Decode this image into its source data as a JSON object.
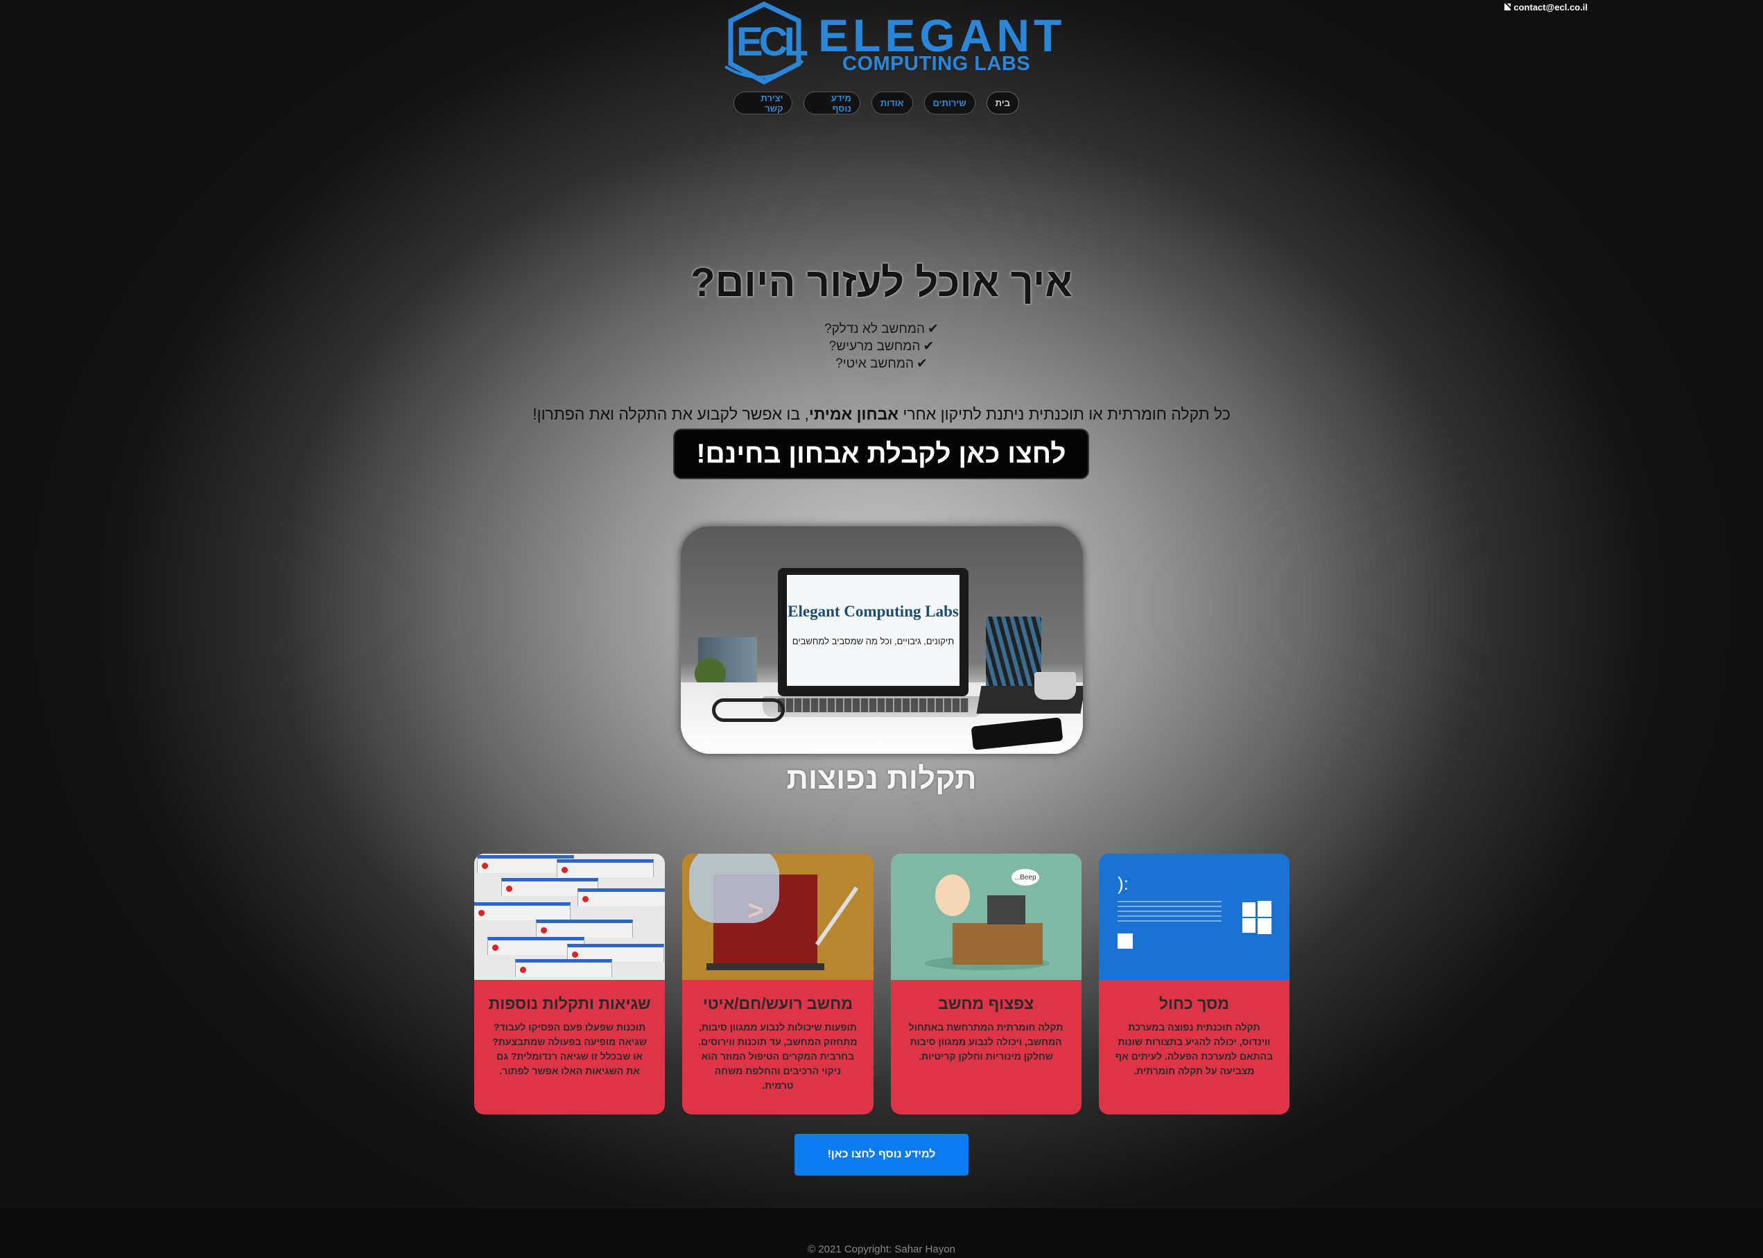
{
  "contact": {
    "email": "contact@ecl.co.il",
    "icon": "envelope-icon"
  },
  "brand": {
    "initials": "ECL",
    "name": "ELEGANT",
    "sub": "COMPUTING LABS",
    "color": "#2a86d8"
  },
  "nav": {
    "items": [
      "בית",
      "שירותים",
      "אודות",
      "מידע נוסף",
      "יצירת קשר"
    ]
  },
  "hero": {
    "title": "איך אוכל לעזור היום?",
    "checks": [
      "המחשב לא נדלק?",
      "המחשב מרעיש?",
      "המחשב איטי?"
    ],
    "statement_before": "כל תקלה חומרתית או תוכנתית ניתנת לתיקון אחרי ",
    "statement_bold": "אבחון אמיתי",
    "statement_after": ", בו אפשר לקבוע את התקלה ואת הפתרון!",
    "cta": "לחצו כאן לקבלת אבחון בחינם!"
  },
  "hero_image": {
    "screen_title": "Elegant Computing Labs",
    "screen_subtitle": "תיקונים, גיבויים, וכל מה שמסביב למחשבים"
  },
  "common_section": {
    "title": "תקלות נפוצות"
  },
  "cards": [
    {
      "title": "מסך כחול",
      "text": "תקלה תוכנתית נפוצה במערכת ווינדוס, יכולה להגיע בתצורות שונות בהתאם למערכת הפעלה. לעיתים אף מצביעה על תקלה חומרתית.",
      "image": "blue-screen"
    },
    {
      "title": "צפצוף מחשב",
      "text": "תקלה חומרתית המתרחשת באתחול המחשב, ויכולה לנבוע ממגוון סיבות שחלקן מינוריות וחלקן קריטיות.",
      "image": "beeping-computer",
      "bubble": "Beep..."
    },
    {
      "title": "מחשב רועש/חם/איטי",
      "text": "תופעות שיכולות לנבוע ממגוון סיבות, מתחזוק המחשב, עד תוכנות ווירוסים. בחרבית המקרים הטיפול המוזר הוא ניקוי הרכיבים והחלפת משחה טרמית.",
      "image": "broken-laptop"
    },
    {
      "title": "שגיאות ותקלות נוספות",
      "text": "תוכנות שפעלו פעם הפסיקו לעבוד? שגיאה מופיעה בפעולה שמתבצעת? או שבכלל זו שגיאה רנדומלית? גם את השגיאות האלו אפשר לפתור.",
      "image": "error-dialogs"
    }
  ],
  "more_button": "למידע נוסף לחצו כאן!",
  "footer": {
    "copyright": "© 2021 Copyright: Sahar Hayon"
  }
}
